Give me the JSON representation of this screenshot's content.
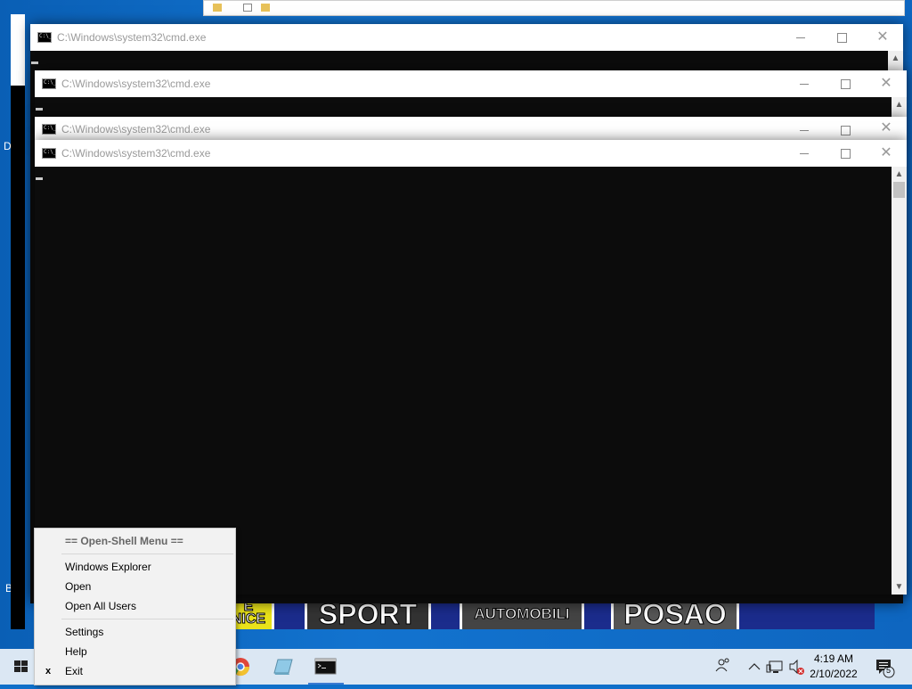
{
  "cmd_windows": [
    {
      "title": "C:\\Windows\\system32\\cmd.exe"
    },
    {
      "title": "C:\\Windows\\system32\\cmd.exe"
    },
    {
      "title": "C:\\Windows\\system32\\cmd.exe"
    },
    {
      "title": "C:\\Windows\\system32\\cmd.exe"
    }
  ],
  "window_controls": {
    "minimize": "—",
    "maximize": "☐",
    "close": "✕"
  },
  "desktop_letters": [
    "D",
    "B"
  ],
  "banner": {
    "tiles": [
      "E\nNICE",
      "SPORT",
      "AUTOMOBILI",
      "POSAO"
    ]
  },
  "context_menu": {
    "header": "== Open-Shell Menu ==",
    "items": [
      "Windows Explorer",
      "Open",
      "Open All Users",
      "Settings",
      "Help",
      "Exit"
    ],
    "exit_mark": "x"
  },
  "taskbar": {
    "icons": [
      "windows-start-icon",
      "chrome-icon",
      "explorer-icon",
      "cmd-icon"
    ],
    "tray_icons": [
      "people-icon",
      "chevron-up-icon",
      "network-icon",
      "volume-muted-icon",
      "notification-icon"
    ],
    "time": "4:19 AM",
    "date": "2/10/2022",
    "notification_count": "5"
  },
  "colors": {
    "taskbar": "#dbe7f3",
    "desktop": "#0f6fc9",
    "console": "#0c0c0c"
  }
}
